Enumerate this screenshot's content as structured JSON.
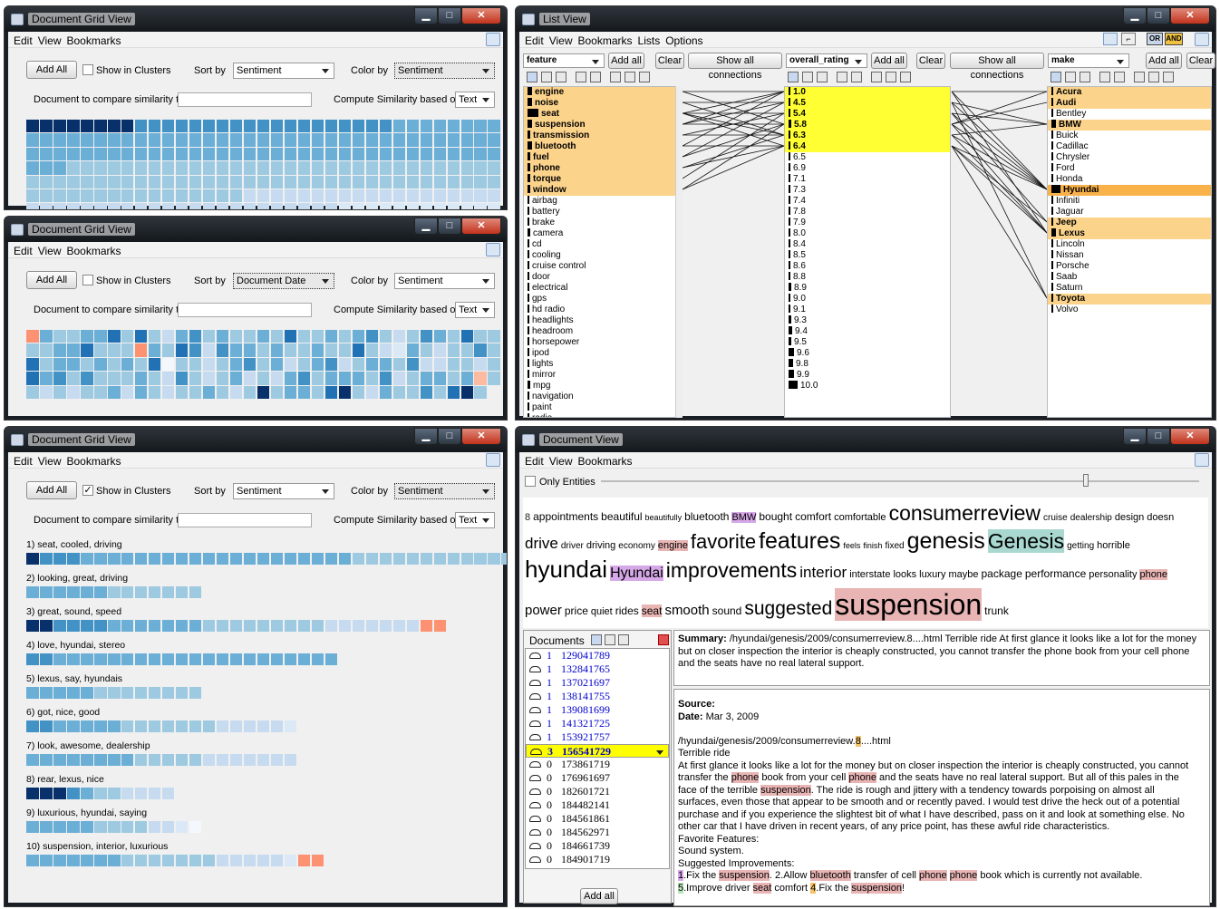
{
  "menus": {
    "grid": [
      "Edit",
      "View",
      "Bookmarks"
    ],
    "list": [
      "Edit",
      "View",
      "Bookmarks",
      "Lists",
      "Options"
    ],
    "doc": [
      "Edit",
      "View",
      "Bookmarks"
    ]
  },
  "grid1": {
    "title": "Document Grid View",
    "add_all": "Add All",
    "show_clusters": "Show in Clusters",
    "show_clusters_checked": false,
    "sort_by_label": "Sort by",
    "sort_by": "Sentiment",
    "color_by_label": "Color by",
    "color_by": "Sentiment",
    "compare_label": "Document to compare similarity to",
    "compute_label": "Compute Similarity based on",
    "compute_value": "Text",
    "cells": "8888888866666666666666666665555555555555555555555555555555555555555555555555555555555555555555555555555555553333333333333333333333333333333333333333333333333333333333333333333333333333333333322222222222222222222222222222222222222222211111111111111111111111111111111111111111111000000111111ABBBC"
  },
  "grid2": {
    "title": "Document Grid View",
    "add_all": "Add All",
    "show_clusters": "Show in Clusters",
    "show_clusters_checked": false,
    "sort_by_label": "Sort by",
    "sort_by": "Document Date",
    "color_by_label": "Color by",
    "color_by": "Sentiment",
    "compare_label": "Document to compare similarity to",
    "compute_label": "Compute Similarity based on",
    "compute_value": "Text",
    "cells": "B533557373256353353733535632365373333557333B5376265535335337321532336373553535370332356352356235536223323756363335326323523256355536235535A33232335253233532383553783253363783"
  },
  "grid3": {
    "title": "Document Grid View",
    "add_all": "Add All",
    "show_clusters": "Show in Clusters",
    "show_clusters_checked": true,
    "sort_by_label": "Sort by",
    "sort_by": "Sentiment",
    "color_by_label": "Color by",
    "color_by": "Sentiment",
    "compare_label": "Document to compare similarity to",
    "compute_label": "Compute Similarity based on",
    "compute_value": "Text",
    "clusters": [
      {
        "label": "1) seat, cooled, driving",
        "cells": "8666555555555555555555553333333333333333222222222221111111111000000B"
      },
      {
        "label": "2) looking, great, driving",
        "cells": "5555553333333"
      },
      {
        "label": "3) great, sound, speed",
        "cells": "88666655555553333333332222222BB"
      },
      {
        "label": "4) love, hyundai, stereo",
        "cells": "66555555555555555555555"
      },
      {
        "label": "5) lexus, say, hyundais",
        "cells": "5555533333333"
      },
      {
        "label": "6) got, nice, good",
        "cells": "66555553333333222221"
      },
      {
        "label": "7) look, awesome, dealership",
        "cells": "55555555333332222222"
      },
      {
        "label": "8) rear, lexus, nice",
        "cells": "88865332222"
      },
      {
        "label": "9) luxurious, hyundai, saying",
        "cells": "5555533332210"
      },
      {
        "label": "10) suspension, interior, luxurious",
        "cells": "55555553333333222221BB"
      }
    ]
  },
  "list_view": {
    "title": "List View",
    "col1_select": "feature",
    "col2_select": "overall_rating",
    "col3_select": "make",
    "add_all": "Add all",
    "clear": "Clear",
    "show_all_connections": "Show all connections",
    "or_label": "OR",
    "and_label": "AND",
    "features": [
      {
        "t": "engine",
        "w": 5,
        "h": 1
      },
      {
        "t": "noise",
        "w": 5,
        "h": 1
      },
      {
        "t": "seat",
        "w": 12,
        "h": 1
      },
      {
        "t": "suspension",
        "w": 5,
        "h": 1
      },
      {
        "t": "transmission",
        "w": 3,
        "h": 1
      },
      {
        "t": "bluetooth",
        "w": 5,
        "h": 1
      },
      {
        "t": "fuel",
        "w": 3,
        "h": 1
      },
      {
        "t": "phone",
        "w": 3,
        "h": 1
      },
      {
        "t": "torque",
        "w": 3,
        "h": 1
      },
      {
        "t": "window",
        "w": 3,
        "h": 1
      },
      {
        "t": "airbag",
        "w": 2,
        "h": 0
      },
      {
        "t": "battery",
        "w": 2,
        "h": 0
      },
      {
        "t": "brake",
        "w": 2,
        "h": 0
      },
      {
        "t": "camera",
        "w": 3,
        "h": 0
      },
      {
        "t": "cd",
        "w": 2,
        "h": 0
      },
      {
        "t": "cooling",
        "w": 2,
        "h": 0
      },
      {
        "t": "cruise control",
        "w": 2,
        "h": 0
      },
      {
        "t": "door",
        "w": 2,
        "h": 0
      },
      {
        "t": "electrical",
        "w": 2,
        "h": 0
      },
      {
        "t": "gps",
        "w": 2,
        "h": 0
      },
      {
        "t": "hd radio",
        "w": 2,
        "h": 0
      },
      {
        "t": "headlights",
        "w": 2,
        "h": 0
      },
      {
        "t": "headroom",
        "w": 2,
        "h": 0
      },
      {
        "t": "horsepower",
        "w": 2,
        "h": 0
      },
      {
        "t": "ipod",
        "w": 2,
        "h": 0
      },
      {
        "t": "lights",
        "w": 2,
        "h": 0
      },
      {
        "t": "mirror",
        "w": 2,
        "h": 0
      },
      {
        "t": "mpg",
        "w": 3,
        "h": 0
      },
      {
        "t": "navigation",
        "w": 2,
        "h": 0
      },
      {
        "t": "paint",
        "w": 2,
        "h": 0
      },
      {
        "t": "radio",
        "w": 2,
        "h": 0
      }
    ],
    "ratings": [
      {
        "t": "1.0",
        "w": 2,
        "h": 1
      },
      {
        "t": "4.5",
        "w": 2,
        "h": 1
      },
      {
        "t": "5.4",
        "w": 2,
        "h": 1
      },
      {
        "t": "5.8",
        "w": 3,
        "h": 1
      },
      {
        "t": "6.3",
        "w": 2,
        "h": 1
      },
      {
        "t": "6.4",
        "w": 2,
        "h": 1
      },
      {
        "t": "6.5",
        "w": 2,
        "h": 0
      },
      {
        "t": "6.9",
        "w": 2,
        "h": 0
      },
      {
        "t": "7.1",
        "w": 2,
        "h": 0
      },
      {
        "t": "7.3",
        "w": 2,
        "h": 0
      },
      {
        "t": "7.4",
        "w": 2,
        "h": 0
      },
      {
        "t": "7.8",
        "w": 2,
        "h": 0
      },
      {
        "t": "7.9",
        "w": 2,
        "h": 0
      },
      {
        "t": "8.0",
        "w": 2,
        "h": 0
      },
      {
        "t": "8.4",
        "w": 2,
        "h": 0
      },
      {
        "t": "8.5",
        "w": 2,
        "h": 0
      },
      {
        "t": "8.6",
        "w": 2,
        "h": 0
      },
      {
        "t": "8.8",
        "w": 2,
        "h": 0
      },
      {
        "t": "8.9",
        "w": 3,
        "h": 0
      },
      {
        "t": "9.0",
        "w": 2,
        "h": 0
      },
      {
        "t": "9.1",
        "w": 2,
        "h": 0
      },
      {
        "t": "9.3",
        "w": 3,
        "h": 0
      },
      {
        "t": "9.4",
        "w": 4,
        "h": 0
      },
      {
        "t": "9.5",
        "w": 3,
        "h": 0
      },
      {
        "t": "9.6",
        "w": 6,
        "h": 0
      },
      {
        "t": "9.8",
        "w": 5,
        "h": 0
      },
      {
        "t": "9.9",
        "w": 6,
        "h": 0
      },
      {
        "t": "10.0",
        "w": 10,
        "h": 0
      }
    ],
    "makes": [
      {
        "t": "Acura",
        "w": 2,
        "h": 1
      },
      {
        "t": "Audi",
        "w": 2,
        "h": 1
      },
      {
        "t": "Bentley",
        "w": 2,
        "h": 0
      },
      {
        "t": "BMW",
        "w": 5,
        "h": 1
      },
      {
        "t": "Buick",
        "w": 2,
        "h": 0
      },
      {
        "t": "Cadillac",
        "w": 2,
        "h": 0
      },
      {
        "t": "Chrysler",
        "w": 2,
        "h": 0
      },
      {
        "t": "Ford",
        "w": 2,
        "h": 0
      },
      {
        "t": "Honda",
        "w": 2,
        "h": 0
      },
      {
        "t": "Hyundai",
        "w": 10,
        "h": 2
      },
      {
        "t": "Infiniti",
        "w": 2,
        "h": 0
      },
      {
        "t": "Jaguar",
        "w": 2,
        "h": 0
      },
      {
        "t": "Jeep",
        "w": 2,
        "h": 1
      },
      {
        "t": "Lexus",
        "w": 5,
        "h": 1
      },
      {
        "t": "Lincoln",
        "w": 2,
        "h": 0
      },
      {
        "t": "Nissan",
        "w": 2,
        "h": 0
      },
      {
        "t": "Porsche",
        "w": 2,
        "h": 0
      },
      {
        "t": "Saab",
        "w": 2,
        "h": 0
      },
      {
        "t": "Saturn",
        "w": 2,
        "h": 0
      },
      {
        "t": "Toyota",
        "w": 2,
        "h": 1
      },
      {
        "t": "Volvo",
        "w": 2,
        "h": 0
      }
    ]
  },
  "doc_view": {
    "title": "Document View",
    "only_entities": "Only Entities",
    "cloud": [
      [
        [
          "8",
          11,
          "#222"
        ],
        [
          "appointments",
          12,
          "#000"
        ],
        [
          "beautiful",
          12,
          "#000"
        ],
        [
          "beautifully",
          9,
          "#000"
        ],
        [
          "bluetooth",
          12,
          "#000"
        ],
        [
          "BMW",
          11,
          "#000",
          "h-v"
        ],
        [
          "bought",
          12,
          "#000"
        ],
        [
          "comfort",
          12,
          "#000"
        ],
        [
          "comfortable",
          11,
          "#000"
        ],
        [
          "consumerreview",
          23,
          "#000"
        ],
        [
          "cruise",
          10,
          "#000"
        ],
        [
          "dealership",
          10,
          "#000"
        ],
        [
          "design",
          11,
          "#000"
        ],
        [
          "doesn",
          11,
          "#000"
        ]
      ],
      [
        [
          "drive",
          17,
          "#000"
        ],
        [
          "driver",
          10,
          "#000"
        ],
        [
          "driving",
          11,
          "#000"
        ],
        [
          "economy",
          10,
          "#000"
        ],
        [
          "engine",
          11,
          "#000",
          "h-p"
        ],
        [
          "favorite",
          22,
          "#000"
        ],
        [
          "features",
          25,
          "#000"
        ],
        [
          "feels",
          9,
          "#000"
        ],
        [
          "finish",
          9,
          "#000"
        ],
        [
          "fixed",
          10,
          "#000"
        ],
        [
          "genesis",
          25,
          "#000"
        ],
        [
          "Genesis",
          23,
          "#000",
          "h-t"
        ],
        [
          "getting",
          10,
          "#000"
        ],
        [
          "horrible",
          11,
          "#000"
        ]
      ],
      [
        [
          "hyundai",
          26,
          "#000"
        ],
        [
          "Hyundai",
          16,
          "#000",
          "h-v"
        ],
        [
          "improvements",
          23,
          "#000"
        ],
        [
          "interior",
          17,
          "#000"
        ],
        [
          "interstate",
          11,
          "#000"
        ],
        [
          "looks",
          11,
          "#000"
        ],
        [
          "luxury",
          11,
          "#000"
        ],
        [
          "maybe",
          11,
          "#000"
        ],
        [
          "package",
          12,
          "#000"
        ],
        [
          "performance",
          12,
          "#000"
        ],
        [
          "personality",
          11,
          "#000"
        ],
        [
          "phone",
          11,
          "#000",
          "h-p"
        ]
      ],
      [
        [
          "power",
          15,
          "#000"
        ],
        [
          "price",
          12,
          "#000"
        ],
        [
          "quiet",
          11,
          "#000"
        ],
        [
          "rides",
          12,
          "#000"
        ],
        [
          "seat",
          12,
          "#000",
          "h-p"
        ],
        [
          "smooth",
          15,
          "#000"
        ],
        [
          "sound",
          12,
          "#000"
        ],
        [
          "suggested",
          21,
          "#000"
        ],
        [
          "suspension",
          32,
          "#000",
          "h-p"
        ],
        [
          "trunk",
          12,
          "#000"
        ]
      ]
    ],
    "docs_label": "Documents",
    "add_all": "Add all",
    "docs": [
      [
        "1",
        "129041789",
        1
      ],
      [
        "1",
        "132841765",
        1
      ],
      [
        "1",
        "137021697",
        1
      ],
      [
        "1",
        "138141755",
        1
      ],
      [
        "1",
        "139081699",
        1
      ],
      [
        "1",
        "141321725",
        1
      ],
      [
        "1",
        "153921757",
        1
      ],
      [
        "3",
        "156541729",
        2
      ],
      [
        "0",
        "173861719",
        0
      ],
      [
        "0",
        "176961697",
        0
      ],
      [
        "0",
        "182601721",
        0
      ],
      [
        "0",
        "184482141",
        0
      ],
      [
        "0",
        "184561861",
        0
      ],
      [
        "0",
        "184562971",
        0
      ],
      [
        "0",
        "184661739",
        0
      ],
      [
        "0",
        "184901719",
        0
      ]
    ],
    "summary_label": "Summary:",
    "summary_text": " /hyundai/genesis/2009/consumerreview.8....html Terrible ride At first glance it looks like a lot for the money but on closer inspection the interior is cheaply constructed, you cannot transfer the phone book from your cell phone and the seats have no real lateral support.",
    "source_label": "Source:",
    "date_label": "Date:",
    "date_value": " Mar 3, 2009",
    "path": "/hyundai/genesis/2009/consumerreview.",
    "path_num": "8",
    "path_end": "....html",
    "headline": "Terrible ride",
    "body": [
      [
        "At first glance it looks like a lot for the money but on closer inspection the interior is cheaply constructed, you cannot transfer the ",
        ""
      ],
      [
        "phone",
        "h-p"
      ],
      [
        " book from your cell ",
        ""
      ],
      [
        "phone",
        "h-p"
      ],
      [
        " and the seats have no real lateral support. But all of this pales in the face of the terrible ",
        ""
      ],
      [
        "suspension",
        "h-p"
      ],
      [
        ". The ride is rough and jittery with a tendency towards porpoising on almost all surfaces, even those that appear to be smooth and or recently paved. I would test drive the heck out of a potential purchase and if you experience the slightest bit of what I have described, pass on it and look at something else. No other car that I have driven in recent years, of any price point, has these awful ride characteristics.",
        ""
      ]
    ],
    "fav": "Favorite Features:",
    "fav_val": "Sound system.",
    "sugg": "Suggested Improvements:",
    "last": [
      [
        "1",
        "h-v"
      ],
      [
        ".Fix the ",
        ""
      ],
      [
        "suspension",
        "h-p"
      ],
      [
        ". 2.Allow ",
        ""
      ],
      [
        "bluetooth",
        "h-p"
      ],
      [
        " transfer of cell ",
        ""
      ],
      [
        "phone",
        "h-p"
      ],
      [
        " ",
        ""
      ],
      [
        "phone",
        "h-p"
      ],
      [
        " book which is currently not available.",
        ""
      ]
    ],
    "last2": [
      [
        "5",
        "h-g"
      ],
      [
        ".Improve driver ",
        ""
      ],
      [
        "seat",
        "h-p"
      ],
      [
        " comfort ",
        ""
      ],
      [
        "4",
        "h-y"
      ],
      [
        ".Fix the ",
        ""
      ],
      [
        "suspension",
        "h-p"
      ],
      [
        "!",
        ""
      ]
    ]
  },
  "colors": {
    "0": "#f4f8fc",
    "1": "#dbe9f6",
    "2": "#c6dbef",
    "3": "#9ecae1",
    "5": "#6baed6",
    "6": "#4292c6",
    "7": "#2171b5",
    "8": "#08306b",
    "A": "#fcbba1",
    "B": "#fc9272",
    "C": "#fb6a4a"
  }
}
